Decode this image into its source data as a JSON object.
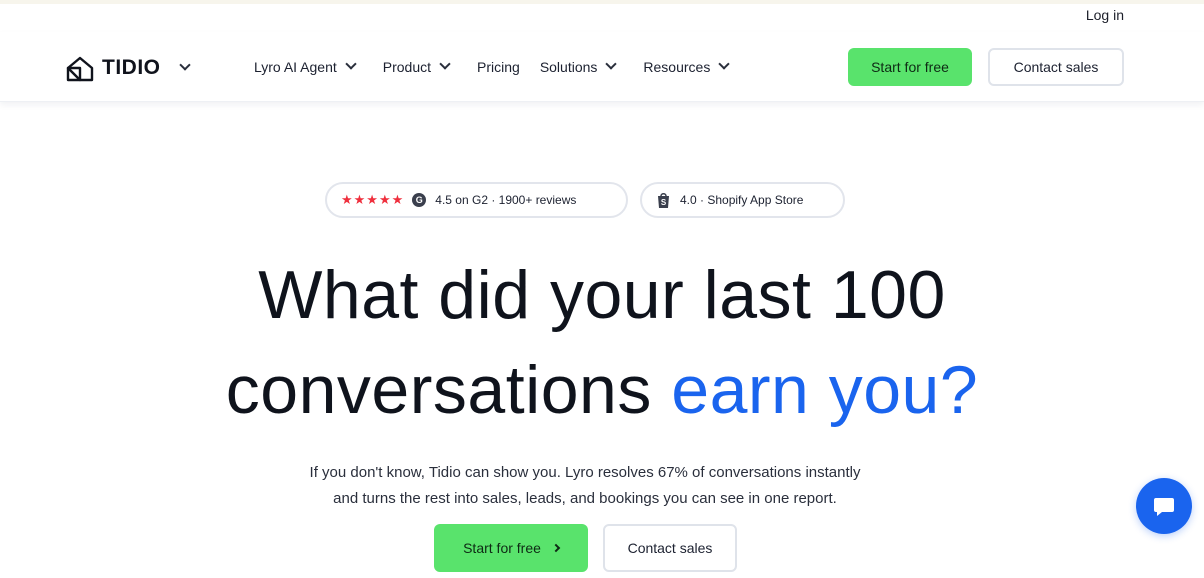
{
  "header": {
    "login_label": "Log in",
    "logo_text": "TIDIO"
  },
  "nav": {
    "items": [
      {
        "label": "Lyro AI Agent",
        "has_dropdown": true
      },
      {
        "label": "Product",
        "has_dropdown": true
      },
      {
        "label": "Pricing",
        "has_dropdown": false
      },
      {
        "label": "Solutions",
        "has_dropdown": true
      },
      {
        "label": "Resources",
        "has_dropdown": true
      }
    ],
    "start_label": "Start for free",
    "contact_label": "Contact sales"
  },
  "badges": {
    "g2_rating": "4.5 on G2 · 1900+ reviews",
    "shopify_rating": "4.0 · Shopify App Store",
    "g2_icon": "G"
  },
  "hero": {
    "headline_line1": "What did your last 100",
    "headline_line2_plain": "conversations ",
    "headline_line2_accent": "earn you?",
    "sub_line1": "If you don't know, Tidio can show you. Lyro resolves 67% of conversations instantly",
    "sub_line2": "and turns the rest into sales, leads, and bookings you can see in one report.",
    "start_label": "Start for free",
    "contact_label": "Contact sales"
  },
  "colors": {
    "accent_blue": "#1a64ee",
    "cta_green": "#59e36c",
    "star_red": "#ef2f3d"
  },
  "icons": {
    "logo": "tidio-logo-icon",
    "chevron": "chevron-down-icon",
    "stars": "star-icon",
    "g2": "g2-icon",
    "shopify": "shopify-icon",
    "arrow": "chevron-right-icon",
    "chat": "chat-bubble-icon"
  }
}
